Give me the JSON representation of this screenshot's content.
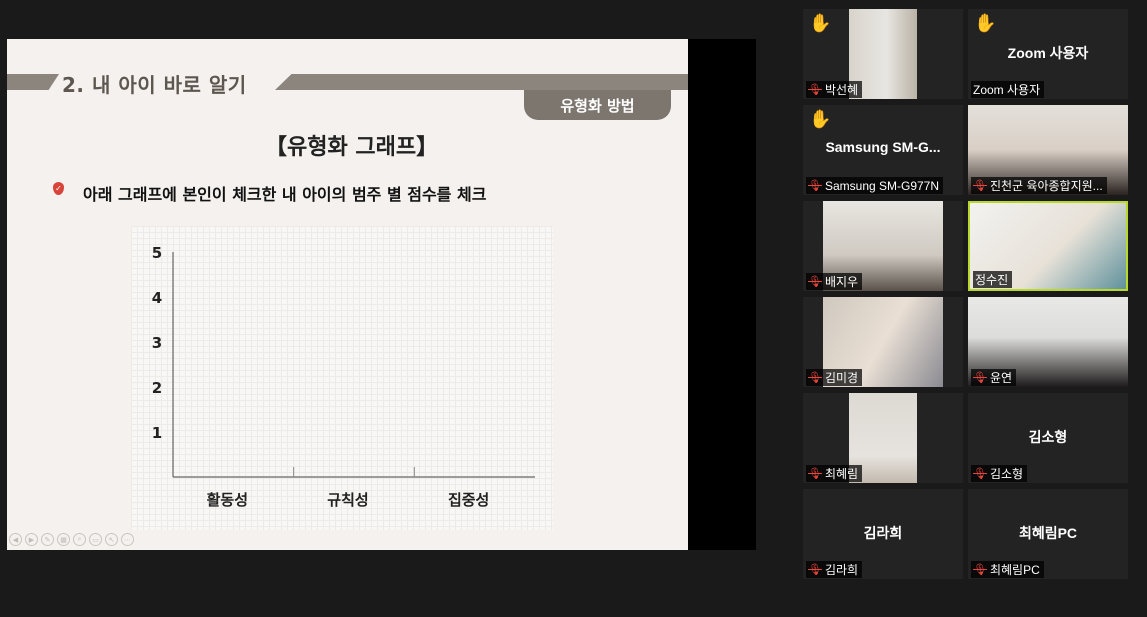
{
  "slide": {
    "heading": "2. 내 아이 바로 알기",
    "method_tab": "유형화 방법",
    "graph_title": "【유형화 그래프】",
    "instruction": "아래 그래프에 본인이 체크한 내 아이의 범주 별 점수를 체크",
    "bullet_icon": "check-badge-icon"
  },
  "chart_data": {
    "type": "bar",
    "categories": [
      "활동성",
      "규칙성",
      "집중성"
    ],
    "values": [],
    "yticks": [
      1,
      2,
      3,
      4,
      5
    ],
    "ylim": [
      0,
      5
    ],
    "title": "",
    "xlabel": "",
    "ylabel": "",
    "grid": false
  },
  "participants": [
    {
      "label": "박선혜",
      "center_name": "",
      "hand_raised": true,
      "muted": true,
      "video": true,
      "active": false
    },
    {
      "label": "Zoom 사용자",
      "center_name": "Zoom 사용자",
      "hand_raised": true,
      "muted": false,
      "video": false,
      "active": false
    },
    {
      "label": "Samsung SM-G977N",
      "center_name": "Samsung SM-G...",
      "hand_raised": true,
      "muted": true,
      "video": false,
      "active": false
    },
    {
      "label": "진천군 육아종합지원...",
      "center_name": "",
      "hand_raised": false,
      "muted": true,
      "video": true,
      "active": false
    },
    {
      "label": "배지우",
      "center_name": "",
      "hand_raised": false,
      "muted": true,
      "video": true,
      "active": false
    },
    {
      "label": "정수진",
      "center_name": "",
      "hand_raised": false,
      "muted": false,
      "video": true,
      "active": true
    },
    {
      "label": "김미경",
      "center_name": "",
      "hand_raised": false,
      "muted": true,
      "video": true,
      "active": false
    },
    {
      "label": "윤연",
      "center_name": "",
      "hand_raised": false,
      "muted": true,
      "video": true,
      "active": false
    },
    {
      "label": "최혜림",
      "center_name": "",
      "hand_raised": false,
      "muted": true,
      "video": true,
      "active": false
    },
    {
      "label": "김소형",
      "center_name": "김소형",
      "hand_raised": false,
      "muted": true,
      "video": false,
      "active": false
    },
    {
      "label": "김라희",
      "center_name": "김라희",
      "hand_raised": false,
      "muted": true,
      "video": false,
      "active": false
    },
    {
      "label": "최혜림PC",
      "center_name": "최혜림PC",
      "hand_raised": false,
      "muted": true,
      "video": false,
      "active": false
    }
  ],
  "colors": {
    "background": "#1a1a1a",
    "tile": "#232323",
    "slide": "#f4f1ee",
    "band": "#8b857e",
    "active_border": "#b9d92a",
    "mic_muted": "#e8463c",
    "hand": "#f2c230"
  },
  "icons": {
    "hand": "raised-hand-icon",
    "mic": "muted-mic-icon"
  }
}
